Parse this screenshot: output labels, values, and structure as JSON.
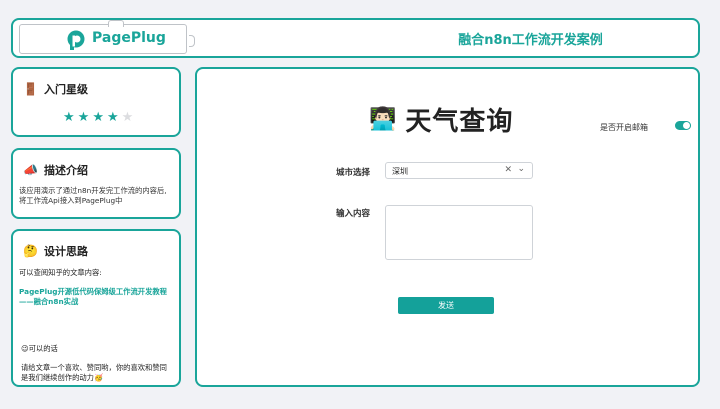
{
  "header": {
    "brand": "PagePlug",
    "title": "融合n8n工作流开发案例"
  },
  "sidebar": {
    "level": {
      "emoji": "🚪",
      "title": "入门星级",
      "rating": 4,
      "max": 5
    },
    "intro": {
      "emoji": "📣",
      "title": "描述介绍",
      "text": "该应用演示了通过n8n开发完工作流的内容后,将工作流Api接入到PagePlug中"
    },
    "design": {
      "emoji": "🤔",
      "title": "设计思路",
      "line1": "可以查阅知乎的文章内容:",
      "link": "PagePlug开源低代码保姆级工作流开发教程——融合n8n实战",
      "ok_title": "😉可以的话",
      "ok_text": "请给文章一个喜欢、赞同哟，你的喜欢和赞同是我们继续创作的动力🥳"
    }
  },
  "main": {
    "avatar_emoji": "👨🏻‍💻",
    "title": "天气查询",
    "toggle_label": "是否开启邮箱",
    "toggle_on": true,
    "city_label": "城市选择",
    "city_value": "深圳",
    "input_label": "输入内容",
    "input_value": "",
    "submit_label": "发送"
  },
  "colors": {
    "accent": "#1aa59a",
    "background": "#f1f2f6"
  }
}
